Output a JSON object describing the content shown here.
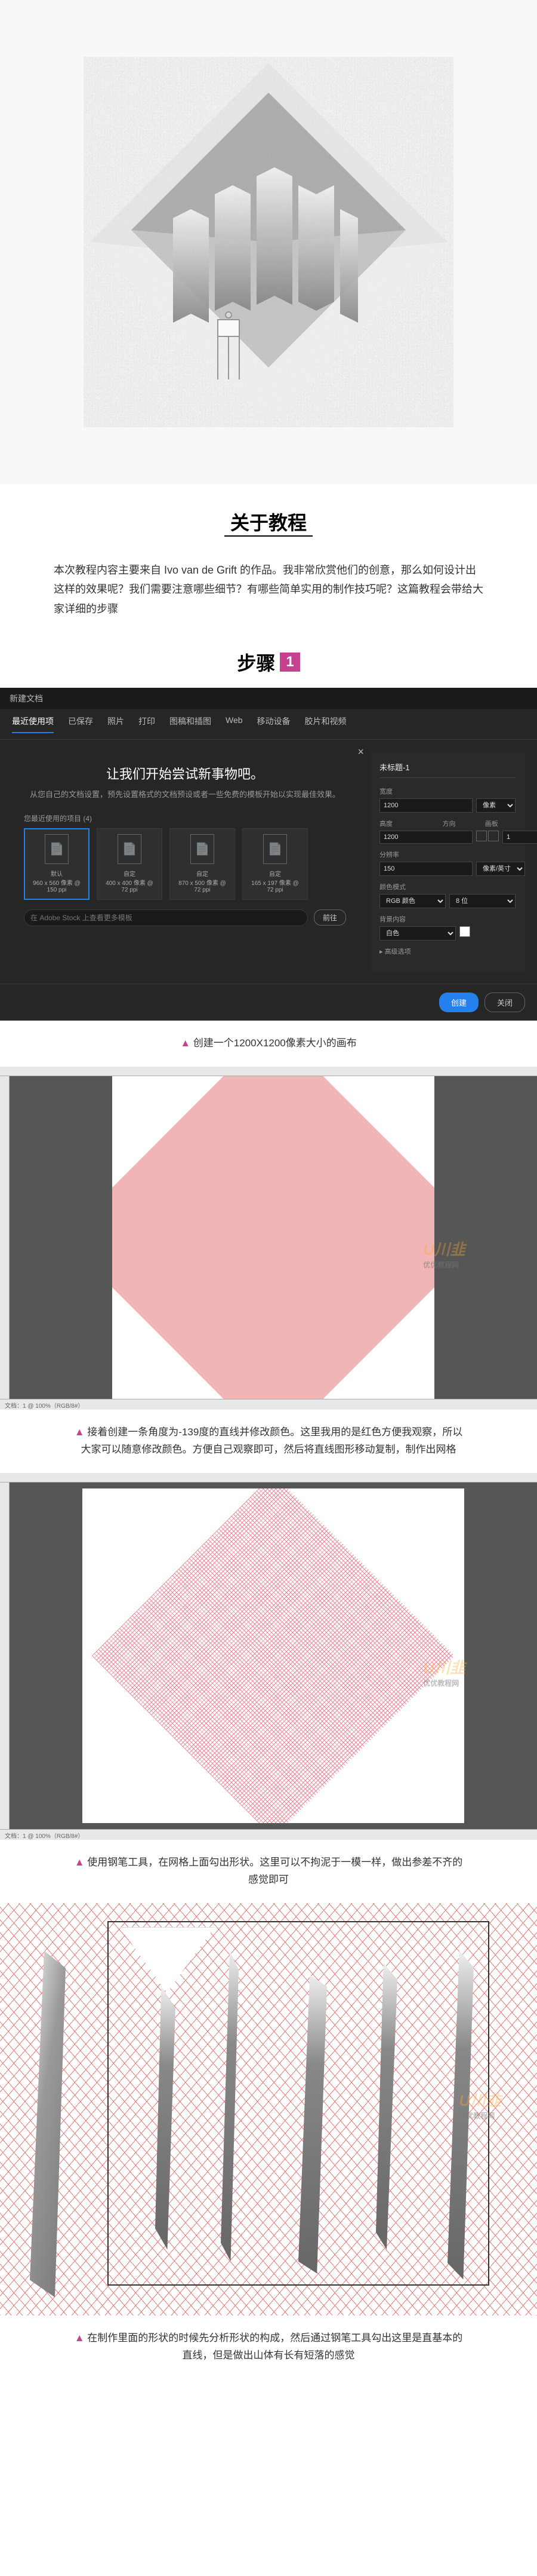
{
  "hero": {
    "title": "关于教程"
  },
  "intro": "本次教程内容主要来自 Ivo van de Grift 的作品。我非常欣赏他们的创意，那么如何设计出这样的效果呢？我们需要注意哪些细节？有哪些简单实用的制作技巧呢？这篇教程会带给大家详细的步骤",
  "step": {
    "label": "步骤",
    "number": "1"
  },
  "dialog": {
    "title": "新建文档",
    "tabs": [
      "最近使用项",
      "已保存",
      "照片",
      "打印",
      "图稿和插图",
      "Web",
      "移动设备",
      "胶片和视频"
    ],
    "active_tab": "最近使用项",
    "headline": "让我们开始尝试新事物吧。",
    "sub": "从您自己的文档设置，预先设置格式的文档预设或者一些免费的模板开始以实现最佳效果。",
    "presets_label": "您最近使用的项目 (4)",
    "presets": [
      {
        "name": "默认",
        "size": "960 x 560 像素 @ 150 ppi",
        "selected": true
      },
      {
        "name": "自定",
        "size": "400 x 400 像素 @ 72 ppi"
      },
      {
        "name": "自定",
        "size": "870 x 500 像素 @ 72 ppi"
      },
      {
        "name": "自定",
        "size": "165 x 197 像素 @ 72 ppi"
      }
    ],
    "search_placeholder": "在 Adobe Stock 上查看更多模板",
    "btn_go": "前往",
    "details": {
      "title": "未标题-1",
      "width_label": "宽度",
      "width": "1200",
      "unit": "像素",
      "height_label": "高度",
      "height": "1200",
      "orient_label": "方向",
      "artboards_label": "画板",
      "artboards": "1",
      "resolution_label": "分辨率",
      "resolution": "150",
      "res_unit": "像素/英寸",
      "colormode_label": "颜色模式",
      "colormode": "RGB 颜色",
      "bit": "8 位",
      "bg_label": "背景内容",
      "bg": "白色",
      "advanced": "▸ 高级选项"
    },
    "btn_create": "创建",
    "btn_close": "关闭"
  },
  "captions": {
    "c1": "创建一个1200X1200像素大小的画布",
    "c2": "接着创建一条角度为-139度的直线并修改颜色。这里我用的是红色方便我观察，所以大家可以随意修改颜色。方便自己观察即可，然后将直线图形移动复制，制作出网格",
    "c3": "使用钢笔工具，在网格上面勾出形状。这里可以不拘泥于一模一样，做出参差不齐的感觉即可",
    "c4": "在制作里面的形状的时候先分析形状的构成，然后通过钢笔工具勾出这里是直基本的直线，但是做出山体有长有短落的感觉"
  },
  "watermark": {
    "brand": "U川韭",
    "sub": "优优教程网"
  },
  "status": "文档：1 @ 100%（RGB/8#）"
}
